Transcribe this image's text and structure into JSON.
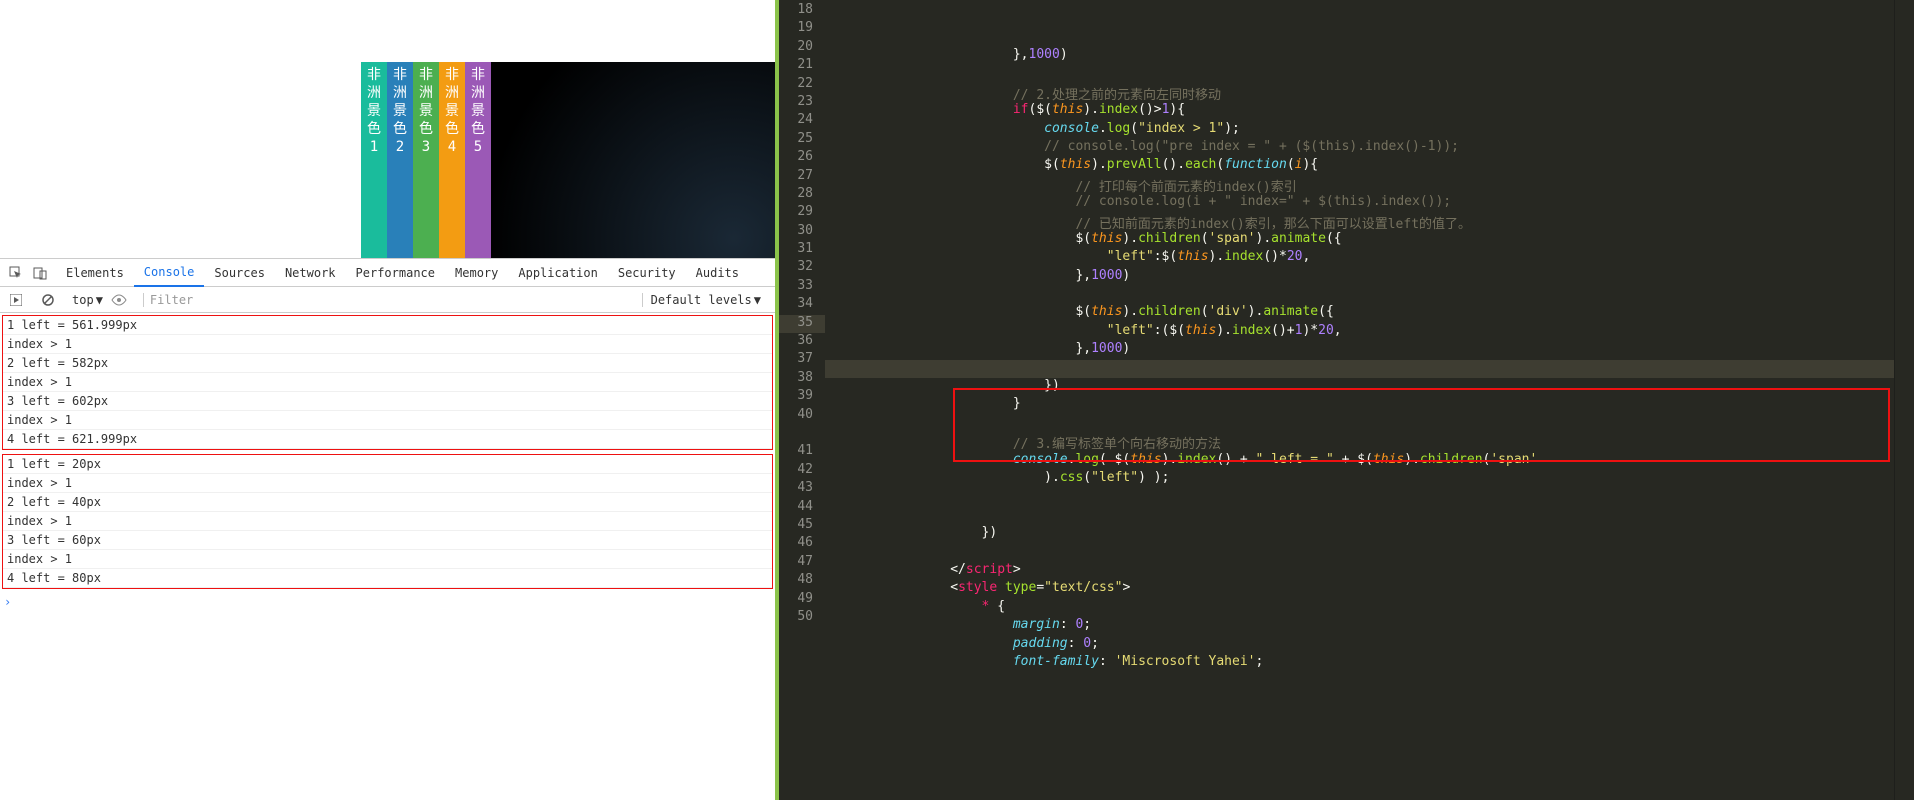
{
  "preview": {
    "tabs": [
      {
        "label": "非洲景色1",
        "color": "#1abc9c"
      },
      {
        "label": "非洲景色2",
        "color": "#2980b9"
      },
      {
        "label": "非洲景色3",
        "color": "#4caf50"
      },
      {
        "label": "非洲景色4",
        "color": "#f39c12"
      },
      {
        "label": "非洲景色5",
        "color": "#9b59b6"
      }
    ]
  },
  "devtools": {
    "tabs": [
      "Elements",
      "Console",
      "Sources",
      "Network",
      "Performance",
      "Memory",
      "Application",
      "Security",
      "Audits"
    ],
    "active_tab": "Console",
    "context": "top",
    "filter_placeholder": "Filter",
    "levels": "Default levels"
  },
  "console_logs": {
    "group1": [
      "1 left = 561.999px",
      "index > 1",
      "2 left = 582px",
      "index > 1",
      "3 left = 602px",
      "index > 1",
      "4 left = 621.999px"
    ],
    "group2": [
      "1 left = 20px",
      "index > 1",
      "2 left = 40px",
      "index > 1",
      "3 left = 60px",
      "index > 1",
      "4 left = 80px"
    ]
  },
  "editor": {
    "line_start": 18,
    "line_end": 50,
    "highlighted_line": 35,
    "lines": [
      {
        "n": 18,
        "indent": 24,
        "tokens": [
          [
            "punc",
            "},"
          ],
          [
            "num",
            "1000"
          ],
          [
            "punc",
            ")"
          ]
        ]
      },
      {
        "n": 19,
        "indent": 0,
        "tokens": []
      },
      {
        "n": 20,
        "indent": 24,
        "tokens": [
          [
            "com",
            "// 2.处理之前的元素向左同时移动"
          ]
        ]
      },
      {
        "n": 21,
        "indent": 24,
        "tokens": [
          [
            "key",
            "if"
          ],
          [
            "punc",
            "($("
          ],
          [
            "obj",
            "this"
          ],
          [
            "punc",
            ")."
          ],
          [
            "fn",
            "index"
          ],
          [
            "punc",
            "()>"
          ],
          [
            "num",
            "1"
          ],
          [
            "punc",
            "){"
          ]
        ]
      },
      {
        "n": 22,
        "indent": 28,
        "tokens": [
          [
            "var",
            "console"
          ],
          [
            "punc",
            "."
          ],
          [
            "fn",
            "log"
          ],
          [
            "punc",
            "("
          ],
          [
            "str",
            "\"index > 1\""
          ],
          [
            "punc",
            ");"
          ]
        ]
      },
      {
        "n": 23,
        "indent": 28,
        "tokens": [
          [
            "com",
            "// console.log(\"pre index = \" + ($(this).index()-1));"
          ]
        ]
      },
      {
        "n": 24,
        "indent": 28,
        "tokens": [
          [
            "punc",
            "$("
          ],
          [
            "obj",
            "this"
          ],
          [
            "punc",
            ")."
          ],
          [
            "fn",
            "prevAll"
          ],
          [
            "punc",
            "()."
          ],
          [
            "fn",
            "each"
          ],
          [
            "punc",
            "("
          ],
          [
            "func",
            "function"
          ],
          [
            "punc",
            "("
          ],
          [
            "obj",
            "i"
          ],
          [
            "punc",
            "){"
          ]
        ]
      },
      {
        "n": 25,
        "indent": 32,
        "tokens": [
          [
            "com",
            "// 打印每个前面元素的index()索引"
          ]
        ]
      },
      {
        "n": 26,
        "indent": 32,
        "tokens": [
          [
            "com",
            "// console.log(i + \" index=\" + $(this).index());"
          ]
        ]
      },
      {
        "n": 27,
        "indent": 32,
        "tokens": [
          [
            "com",
            "// 已知前面元素的index()索引，那么下面可以设置left的值了。"
          ]
        ]
      },
      {
        "n": 28,
        "indent": 32,
        "tokens": [
          [
            "punc",
            "$("
          ],
          [
            "obj",
            "this"
          ],
          [
            "punc",
            ")."
          ],
          [
            "fn",
            "children"
          ],
          [
            "punc",
            "("
          ],
          [
            "str",
            "'span'"
          ],
          [
            "punc",
            ")."
          ],
          [
            "fn",
            "animate"
          ],
          [
            "punc",
            "({"
          ]
        ]
      },
      {
        "n": 29,
        "indent": 36,
        "tokens": [
          [
            "str",
            "\"left\""
          ],
          [
            "punc",
            ":$("
          ],
          [
            "obj",
            "this"
          ],
          [
            "punc",
            ")."
          ],
          [
            "fn",
            "index"
          ],
          [
            "punc",
            "()*"
          ],
          [
            "num",
            "20"
          ],
          [
            "punc",
            ","
          ]
        ]
      },
      {
        "n": 30,
        "indent": 32,
        "tokens": [
          [
            "punc",
            "},"
          ],
          [
            "num",
            "1000"
          ],
          [
            "punc",
            ")"
          ]
        ]
      },
      {
        "n": 31,
        "indent": 0,
        "tokens": []
      },
      {
        "n": 32,
        "indent": 32,
        "tokens": [
          [
            "punc",
            "$("
          ],
          [
            "obj",
            "this"
          ],
          [
            "punc",
            ")."
          ],
          [
            "fn",
            "children"
          ],
          [
            "punc",
            "("
          ],
          [
            "str",
            "'div'"
          ],
          [
            "punc",
            ")."
          ],
          [
            "fn",
            "animate"
          ],
          [
            "punc",
            "({"
          ]
        ]
      },
      {
        "n": 33,
        "indent": 36,
        "tokens": [
          [
            "str",
            "\"left\""
          ],
          [
            "punc",
            ":($("
          ],
          [
            "obj",
            "this"
          ],
          [
            "punc",
            ")."
          ],
          [
            "fn",
            "index"
          ],
          [
            "punc",
            "()+"
          ],
          [
            "num",
            "1"
          ],
          [
            "punc",
            ")*"
          ],
          [
            "num",
            "20"
          ],
          [
            "punc",
            ","
          ]
        ]
      },
      {
        "n": 34,
        "indent": 32,
        "tokens": [
          [
            "punc",
            "},"
          ],
          [
            "num",
            "1000"
          ],
          [
            "punc",
            ")"
          ]
        ]
      },
      {
        "n": 35,
        "indent": 0,
        "tokens": []
      },
      {
        "n": 36,
        "indent": 28,
        "tokens": [
          [
            "punc",
            "})"
          ]
        ]
      },
      {
        "n": 37,
        "indent": 24,
        "tokens": [
          [
            "punc",
            "}"
          ]
        ]
      },
      {
        "n": 38,
        "indent": 0,
        "tokens": []
      },
      {
        "n": 39,
        "indent": 24,
        "tokens": [
          [
            "com",
            "// 3.编写标签单个向右移动的方法"
          ]
        ]
      },
      {
        "n": 40,
        "indent": 24,
        "tokens": [
          [
            "var",
            "console"
          ],
          [
            "punc",
            "."
          ],
          [
            "fn",
            "log"
          ],
          [
            "punc",
            "( $("
          ],
          [
            "obj",
            "this"
          ],
          [
            "punc",
            ")."
          ],
          [
            "fn",
            "index"
          ],
          [
            "punc",
            "() + "
          ],
          [
            "str",
            "\" left = \""
          ],
          [
            "punc",
            " + $("
          ],
          [
            "obj",
            "this"
          ],
          [
            "punc",
            ")."
          ],
          [
            "fn",
            "children"
          ],
          [
            "punc",
            "("
          ],
          [
            "str",
            "'span'"
          ]
        ]
      },
      {
        "n": "",
        "indent": 28,
        "tokens": [
          [
            "punc",
            ")."
          ],
          [
            "fn",
            "css"
          ],
          [
            "punc",
            "("
          ],
          [
            "str",
            "\"left\""
          ],
          [
            "punc",
            ") );"
          ]
        ]
      },
      {
        "n": 41,
        "indent": 0,
        "tokens": []
      },
      {
        "n": 42,
        "indent": 0,
        "tokens": []
      },
      {
        "n": 43,
        "indent": 20,
        "tokens": [
          [
            "punc",
            "})"
          ]
        ]
      },
      {
        "n": 44,
        "indent": 0,
        "tokens": []
      },
      {
        "n": 45,
        "indent": 16,
        "tokens": [
          [
            "punc",
            "</"
          ],
          [
            "tag",
            "script"
          ],
          [
            "punc",
            ">"
          ]
        ]
      },
      {
        "n": 46,
        "indent": 16,
        "tokens": [
          [
            "punc",
            "<"
          ],
          [
            "tag",
            "style"
          ],
          [
            "punc",
            " "
          ],
          [
            "attr",
            "type"
          ],
          [
            "punc",
            "="
          ],
          [
            "str",
            "\"text/css\""
          ],
          [
            "punc",
            ">"
          ]
        ]
      },
      {
        "n": 47,
        "indent": 20,
        "tokens": [
          [
            "tag",
            "*"
          ],
          [
            "punc",
            " {"
          ]
        ]
      },
      {
        "n": 48,
        "indent": 24,
        "tokens": [
          [
            "var",
            "margin"
          ],
          [
            "punc",
            ": "
          ],
          [
            "num",
            "0"
          ],
          [
            "punc",
            ";"
          ]
        ]
      },
      {
        "n": 49,
        "indent": 24,
        "tokens": [
          [
            "var",
            "padding"
          ],
          [
            "punc",
            ": "
          ],
          [
            "num",
            "0"
          ],
          [
            "punc",
            ";"
          ]
        ]
      },
      {
        "n": 50,
        "indent": 24,
        "tokens": [
          [
            "var",
            "font-family"
          ],
          [
            "punc",
            ": "
          ],
          [
            "str",
            "'Miscrosoft Yahei'"
          ],
          [
            "punc",
            ";"
          ]
        ]
      }
    ],
    "red_box_lines": [
      39,
      41
    ]
  }
}
